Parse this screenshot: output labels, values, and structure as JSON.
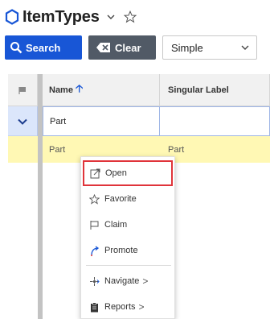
{
  "header": {
    "title": "ItemTypes",
    "icon": "hexagon-outline-icon",
    "menu_icon": "chevron-down-icon",
    "favorite_icon": "star-outline-icon"
  },
  "toolbar": {
    "search_label": "Search",
    "clear_label": "Clear",
    "mode_select": {
      "value": "Simple"
    }
  },
  "grid": {
    "columns": [
      {
        "label": "Name",
        "sort": "ascending"
      },
      {
        "label": "Singular Label"
      }
    ],
    "search_row": {
      "name": "Part",
      "singular_label": ""
    },
    "rows": [
      {
        "name": "Part",
        "singular_label": "Part"
      }
    ]
  },
  "context_menu": {
    "items": [
      {
        "label": "Open",
        "icon": "open-external-icon",
        "highlighted": true
      },
      {
        "label": "Favorite",
        "icon": "star-outline-icon"
      },
      {
        "label": "Claim",
        "icon": "flag-outline-icon"
      },
      {
        "label": "Promote",
        "icon": "promote-arc-icon"
      },
      {
        "label": "Navigate",
        "icon": "navigate-icon",
        "submenu": ">"
      },
      {
        "label": "Reports",
        "icon": "clipboard-icon",
        "submenu": ">"
      }
    ]
  },
  "colors": {
    "primary": "#1856d6",
    "clear_button": "#515a66",
    "selected_row": "#fff8b4",
    "search_row": "#dbe6fb",
    "highlight_border": "#e0343a"
  }
}
